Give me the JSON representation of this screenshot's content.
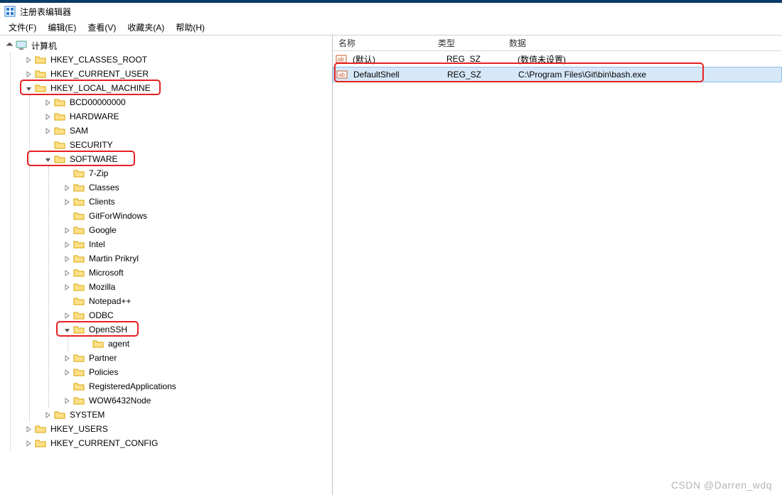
{
  "window": {
    "title": "注册表编辑器"
  },
  "menu": {
    "file": "文件(F)",
    "edit": "编辑(E)",
    "view": "查看(V)",
    "favorites": "收藏夹(A)",
    "help": "帮助(H)"
  },
  "tree": {
    "root": "计算机",
    "hkcr": "HKEY_CLASSES_ROOT",
    "hkcu": "HKEY_CURRENT_USER",
    "hklm": "HKEY_LOCAL_MACHINE",
    "hklm_children": {
      "bcd": "BCD00000000",
      "hardware": "HARDWARE",
      "sam": "SAM",
      "security": "SECURITY",
      "software": "SOFTWARE",
      "system": "SYSTEM"
    },
    "software_children": {
      "7zip": "7-Zip",
      "classes": "Classes",
      "clients": "Clients",
      "gitforwindows": "GitForWindows",
      "google": "Google",
      "intel": "Intel",
      "martin": "Martin Prikryl",
      "microsoft": "Microsoft",
      "mozilla": "Mozilla",
      "notepadpp": "Notepad++",
      "odbc": "ODBC",
      "openssh": "OpenSSH",
      "openssh_children": {
        "agent": "agent"
      },
      "partner": "Partner",
      "policies": "Policies",
      "regapps": "RegisteredApplications",
      "wow64": "WOW6432Node"
    },
    "hku": "HKEY_USERS",
    "hkcc": "HKEY_CURRENT_CONFIG"
  },
  "list": {
    "headers": {
      "name": "名称",
      "type": "类型",
      "data": "数据"
    },
    "rows": [
      {
        "name": "(默认)",
        "type": "REG_SZ",
        "data": "(数值未设置)",
        "icon": "string-value",
        "selected": false
      },
      {
        "name": "DefaultShell",
        "type": "REG_SZ",
        "data": "C:\\Program Files\\Git\\bin\\bash.exe",
        "icon": "string-value",
        "selected": true
      }
    ]
  },
  "watermark": "CSDN @Darren_wdq"
}
